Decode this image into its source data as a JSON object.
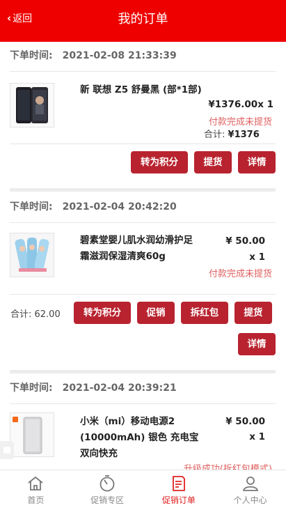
{
  "header": {
    "back_label": "返回",
    "title": "我的订单"
  },
  "orders": [
    {
      "time_label": "下单时间:",
      "time": "2021-02-08 21:33:39",
      "product": "新 联想 Z5 舒曼黑 (部*1部)",
      "price": "¥1376.00x 1",
      "status": "付款完成未提货",
      "total_label": "合计:",
      "total": "¥1376",
      "buttons": [
        "转为积分",
        "提货",
        "详情"
      ]
    },
    {
      "time_label": "下单时间:",
      "time": "2021-02-04 20:42:20",
      "product_line1": "碧素堂婴儿肌水润幼滑护足",
      "product_line2": "霜滋润保湿清爽60g",
      "price": "¥ 50.00",
      "qty": "x 1",
      "status": "付款完成未提货",
      "total": "合计: 62.00",
      "buttons": [
        "转为积分",
        "促销",
        "拆红包",
        "提货",
        "详情"
      ]
    },
    {
      "time_label": "下单时间:",
      "time": "2021-02-04 20:39:21",
      "product_line1": "小米（mi）移动电源2",
      "product_line2": "(10000mAh) 银色 充电宝",
      "product_line3": "双向快充",
      "price": "¥ 50.00",
      "qty": "x 1",
      "status": "升级成功(拆红包模式)"
    }
  ],
  "tabbar": [
    {
      "label": "首页",
      "icon": "home-icon"
    },
    {
      "label": "促销专区",
      "icon": "promo-icon"
    },
    {
      "label": "促销订单",
      "icon": "order-icon",
      "active": true
    },
    {
      "label": "个人中心",
      "icon": "user-icon"
    }
  ],
  "colors": {
    "header": "#ee0000",
    "button": "#b8232f",
    "status": "#e06060",
    "active_tab": "#e02020"
  }
}
